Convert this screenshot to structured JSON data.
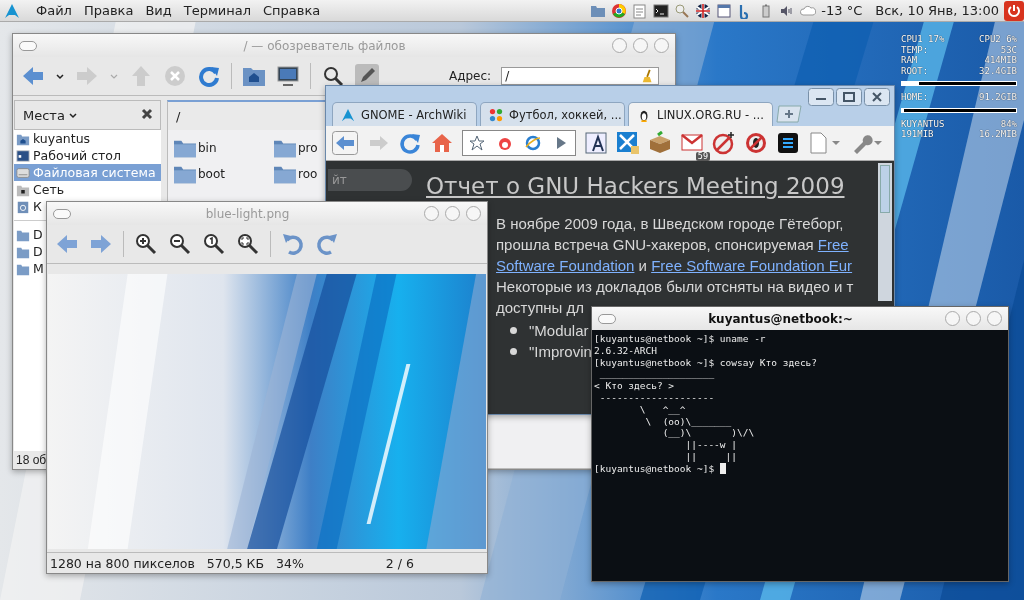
{
  "top_panel": {
    "menus": [
      "Файл",
      "Правка",
      "Вид",
      "Терминал",
      "Справка"
    ],
    "weather": "-13 °C",
    "clock": "Вск, 10 Янв, 13:00"
  },
  "conky": {
    "rows": [
      {
        "kind": "stat",
        "label": "CPU1 17%",
        "value": "CPU2 6%"
      },
      {
        "kind": "stat",
        "label": "TEMP:",
        "value": "53C"
      },
      {
        "kind": "stat",
        "label": "RAM",
        "value": "414MIB"
      },
      {
        "kind": "stat",
        "label": "ROOT:",
        "value": "32.4GIB"
      },
      {
        "kind": "bar",
        "level": 0.85
      },
      {
        "kind": "stat",
        "label": "HOME:",
        "value": "91.2GIB"
      },
      {
        "kind": "bar",
        "level": 0.98
      },
      {
        "kind": "stat",
        "label": "KUYANTUS",
        "value": "84%"
      },
      {
        "kind": "stat",
        "label": "191MIB",
        "value": "16.2MIB"
      }
    ]
  },
  "file_manager": {
    "title": "/ — обозреватель файлов",
    "address_label": "Адрес:",
    "address": "/",
    "places_label": "Места",
    "places": [
      {
        "kind": "home",
        "label": "kuyantus",
        "selected": false
      },
      {
        "kind": "desktop",
        "label": "Рабочий стол",
        "selected": false
      },
      {
        "kind": "drive",
        "label": "Файловая система",
        "selected": true
      },
      {
        "kind": "network",
        "label": "Сеть",
        "selected": false
      },
      {
        "kind": "trash",
        "label": "К",
        "selected": false
      }
    ],
    "bookmarks": [
      "D",
      "D",
      "M"
    ],
    "path": "/",
    "folders": [
      "bin",
      "pro",
      "boot",
      "roo"
    ],
    "status": "18 об"
  },
  "browser": {
    "tabs": [
      {
        "label": "GNOME - ArchWiki",
        "selected": false
      },
      {
        "label": "Футбол, хоккей, ...",
        "selected": false
      },
      {
        "label": "LINUX.ORG.RU - ...",
        "selected": true
      }
    ],
    "badge": "59",
    "search_fragment": "йт",
    "heading": "Отчет о GNU Hackers Meeting 2009",
    "paragraph": [
      [
        {
          "kind": "text",
          "text": "В ноябре 2009 года, в Шведском городе Гётеборг,"
        }
      ],
      [
        {
          "kind": "text",
          "text": "прошла встреча GNU-хакеров, спонсируемая "
        },
        {
          "kind": "link",
          "text": "Free"
        }
      ],
      [
        {
          "kind": "link",
          "text": "Software Foundation"
        },
        {
          "kind": "text",
          "text": " и "
        },
        {
          "kind": "link",
          "text": "Free Software Foundation Eur"
        }
      ],
      [
        {
          "kind": "text",
          "text": "Некоторые из докладов были отсняты на видео и т"
        }
      ],
      [
        {
          "kind": "text",
          "text": "доступны дл"
        }
      ]
    ],
    "bullets": [
      "\"Modular",
      "\"Improvin"
    ]
  },
  "image_viewer": {
    "title": "blue-light.png",
    "status": [
      "1280 на 800 пикселов",
      "570,5 КБ",
      "34%"
    ],
    "page": "2 / 6"
  },
  "terminal": {
    "title": "kuyantus@netbook:~",
    "lines": [
      "[kuyantus@netbook ~]$ uname -r",
      "2.6.32-ARCH",
      "[kuyantus@netbook ~]$ cowsay Кто здесь?",
      " ____________________",
      "< Кто здесь? >",
      " --------------------",
      "        \\   ^__^",
      "         \\  (oo)\\_______",
      "            (__)\\       )\\/\\",
      "                ||----w |",
      "                ||     ||",
      "[kuyantus@netbook ~]$ "
    ]
  }
}
